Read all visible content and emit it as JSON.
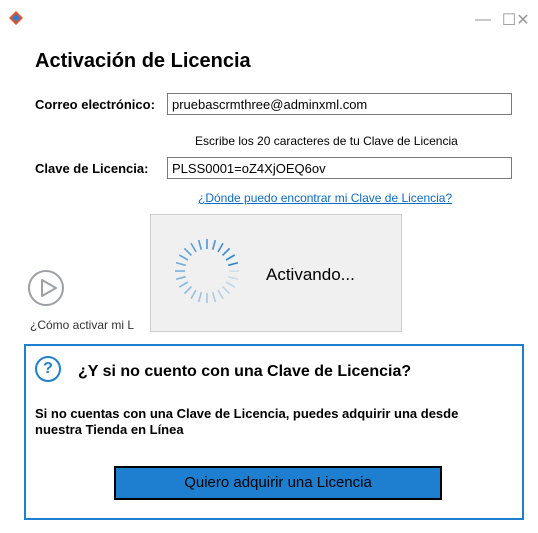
{
  "window": {
    "app_icon": "app-logo-icon",
    "minimize_glyph": "—",
    "maximize_glyph": "☐",
    "close_glyph": "✕"
  },
  "heading": "Activación de Licencia",
  "email": {
    "label": "Correo electrónico:",
    "value": "pruebascrmthree@adminxml.com"
  },
  "license": {
    "hint": "Escribe los 20 caracteres de tu Clave de Licencia",
    "label": "Clave de Licencia:",
    "value": "PLSS0001=oZ4XjOEQ6ov",
    "help_link": "¿Dónde puedo encontrar mi Clave de Licencia?"
  },
  "video": {
    "icon": "play-circle-icon",
    "label": "¿Cómo activar mi L"
  },
  "progress": {
    "icon": "spinner-icon",
    "label": "Activando..."
  },
  "no_license": {
    "icon": "question-circle-icon",
    "question_glyph": "?",
    "title": "¿Y si no cuento con una Clave de Licencia?",
    "body": "Si no cuentas con una Clave de Licencia, puedes adquirir una desde nuestra Tienda en Línea",
    "button_label": "Quiero adquirir una Licencia"
  },
  "colors": {
    "accent": "#1e7fd1",
    "link": "#0b6cc6",
    "overlay_bg": "#f0f0f0"
  }
}
